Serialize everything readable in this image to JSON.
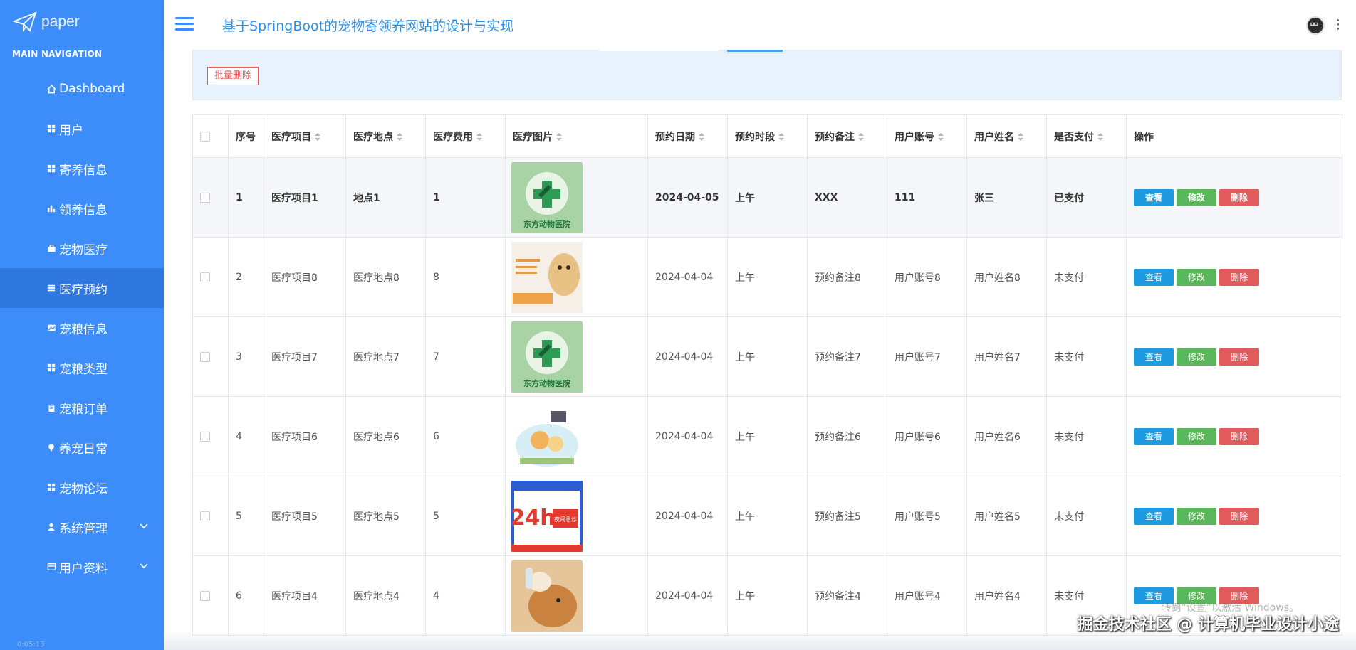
{
  "brand": {
    "name": "paper"
  },
  "nav_title": "MAIN NAVIGATION",
  "sidebar": {
    "items": [
      {
        "label": "Dashboard",
        "icon": "home-icon"
      },
      {
        "label": "用户",
        "icon": "grid-icon"
      },
      {
        "label": "寄养信息",
        "icon": "grid-icon"
      },
      {
        "label": "领养信息",
        "icon": "bar-chart-icon"
      },
      {
        "label": "宠物医疗",
        "icon": "briefcase-icon"
      },
      {
        "label": "医疗预约",
        "icon": "list-icon",
        "active": true
      },
      {
        "label": "宠粮信息",
        "icon": "image-icon"
      },
      {
        "label": "宠粮类型",
        "icon": "grid-icon"
      },
      {
        "label": "宠粮订单",
        "icon": "clipboard-icon"
      },
      {
        "label": "养宠日常",
        "icon": "pin-icon"
      },
      {
        "label": "宠物论坛",
        "icon": "grid-icon"
      },
      {
        "label": "系统管理",
        "icon": "user-icon",
        "expandable": true
      },
      {
        "label": "用户资料",
        "icon": "card-icon",
        "expandable": true
      }
    ],
    "timestamp": "0:05:13"
  },
  "header": {
    "title": "基于SpringBoot的宠物寄领养网站的设计与实现"
  },
  "toolbar": {
    "batch_delete": "批量删除"
  },
  "table": {
    "columns": [
      "序号",
      "医疗项目",
      "医疗地点",
      "医疗费用",
      "医疗图片",
      "预约日期",
      "预约时段",
      "预约备注",
      "用户账号",
      "用户姓名",
      "是否支付",
      "操作"
    ],
    "rows": [
      {
        "no": "1",
        "item": "医疗项目1",
        "place": "地点1",
        "fee": "1",
        "img": "hospital-logo-green",
        "date": "2024-04-05",
        "slot": "上午",
        "note": "XXX",
        "account": "111",
        "name": "张三",
        "paid": "已支付"
      },
      {
        "no": "2",
        "item": "医疗项目8",
        "place": "医疗地点8",
        "fee": "8",
        "img": "dog-poster",
        "date": "2024-04-04",
        "slot": "上午",
        "note": "预约备注8",
        "account": "用户账号8",
        "name": "用户姓名8",
        "paid": "未支付"
      },
      {
        "no": "3",
        "item": "医疗项目7",
        "place": "医疗地点7",
        "fee": "7",
        "img": "hospital-logo-green",
        "date": "2024-04-04",
        "slot": "上午",
        "note": "预约备注7",
        "account": "用户账号7",
        "name": "用户姓名7",
        "paid": "未支付"
      },
      {
        "no": "4",
        "item": "医疗项目6",
        "place": "医疗地点6",
        "fee": "6",
        "img": "cartoon-pets",
        "date": "2024-04-04",
        "slot": "上午",
        "note": "预约备注6",
        "account": "用户账号6",
        "name": "用户姓名6",
        "paid": "未支付"
      },
      {
        "no": "5",
        "item": "医疗项目5",
        "place": "医疗地点5",
        "fee": "5",
        "img": "24h-poster",
        "date": "2024-04-04",
        "slot": "上午",
        "note": "预约备注5",
        "account": "用户账号5",
        "name": "用户姓名5",
        "paid": "未支付"
      },
      {
        "no": "6",
        "item": "医疗项目4",
        "place": "医疗地点4",
        "fee": "4",
        "img": "shiba-photo",
        "date": "2024-04-04",
        "slot": "上午",
        "note": "预约备注4",
        "account": "用户账号4",
        "name": "用户姓名4",
        "paid": "未支付"
      }
    ],
    "actions": {
      "view": "查看",
      "edit": "修改",
      "delete": "删除"
    }
  },
  "image_text": {
    "hospital": "东方动物医院",
    "poster_24h": "24h",
    "poster_night": "夜间急诊"
  },
  "watermark": "掘金技术社区 @ 计算机毕业设计小途",
  "os_notice": "转到“设置”以激活 Windows。",
  "colors": {
    "sidebar": "#3c8dfa",
    "active": "#2e78df",
    "view": "#1e9ae0",
    "edit": "#5bb75b",
    "delete": "#e25b5b",
    "title": "#2b8ee6"
  }
}
